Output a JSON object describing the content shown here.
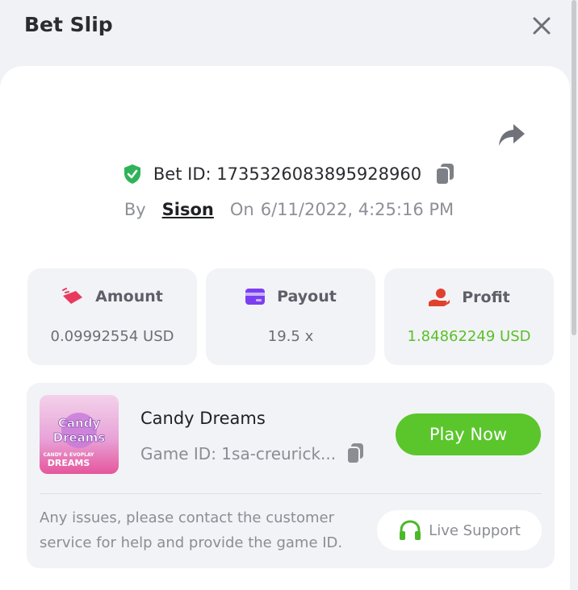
{
  "header": {
    "title": "Bet Slip"
  },
  "bet": {
    "id_label": "Bet ID: 1735326083895928960",
    "by_label": "By",
    "user": "Sison",
    "on_label": "On",
    "datetime": "6/11/2022, 4:25:16 PM"
  },
  "stats": [
    {
      "label": "Amount",
      "value": "0.09992554 USD",
      "icon": "amount-icon"
    },
    {
      "label": "Payout",
      "value": "19.5 x",
      "icon": "payout-card-icon"
    },
    {
      "label": "Profit",
      "value": "1.84862249 USD",
      "icon": "profit-hand-icon"
    }
  ],
  "game": {
    "name": "Candy Dreams",
    "id_label": "Game ID: 1sa-creurick...",
    "play_label": "Play Now",
    "help_text": "Any issues, please contact the customer service for help and provide the game ID.",
    "support_label": "Live Support",
    "thumb_text": {
      "line1": "Candy",
      "line2": "Dreams",
      "small": "CANDY & EVOPLAY",
      "big": "DREAMS"
    }
  },
  "colors": {
    "accent_green": "#5ac62c",
    "profit_green": "#5ac02a",
    "amount_red": "#e83a5f",
    "payout_purple": "#7b3ff2",
    "profit_red": "#e0412f"
  }
}
